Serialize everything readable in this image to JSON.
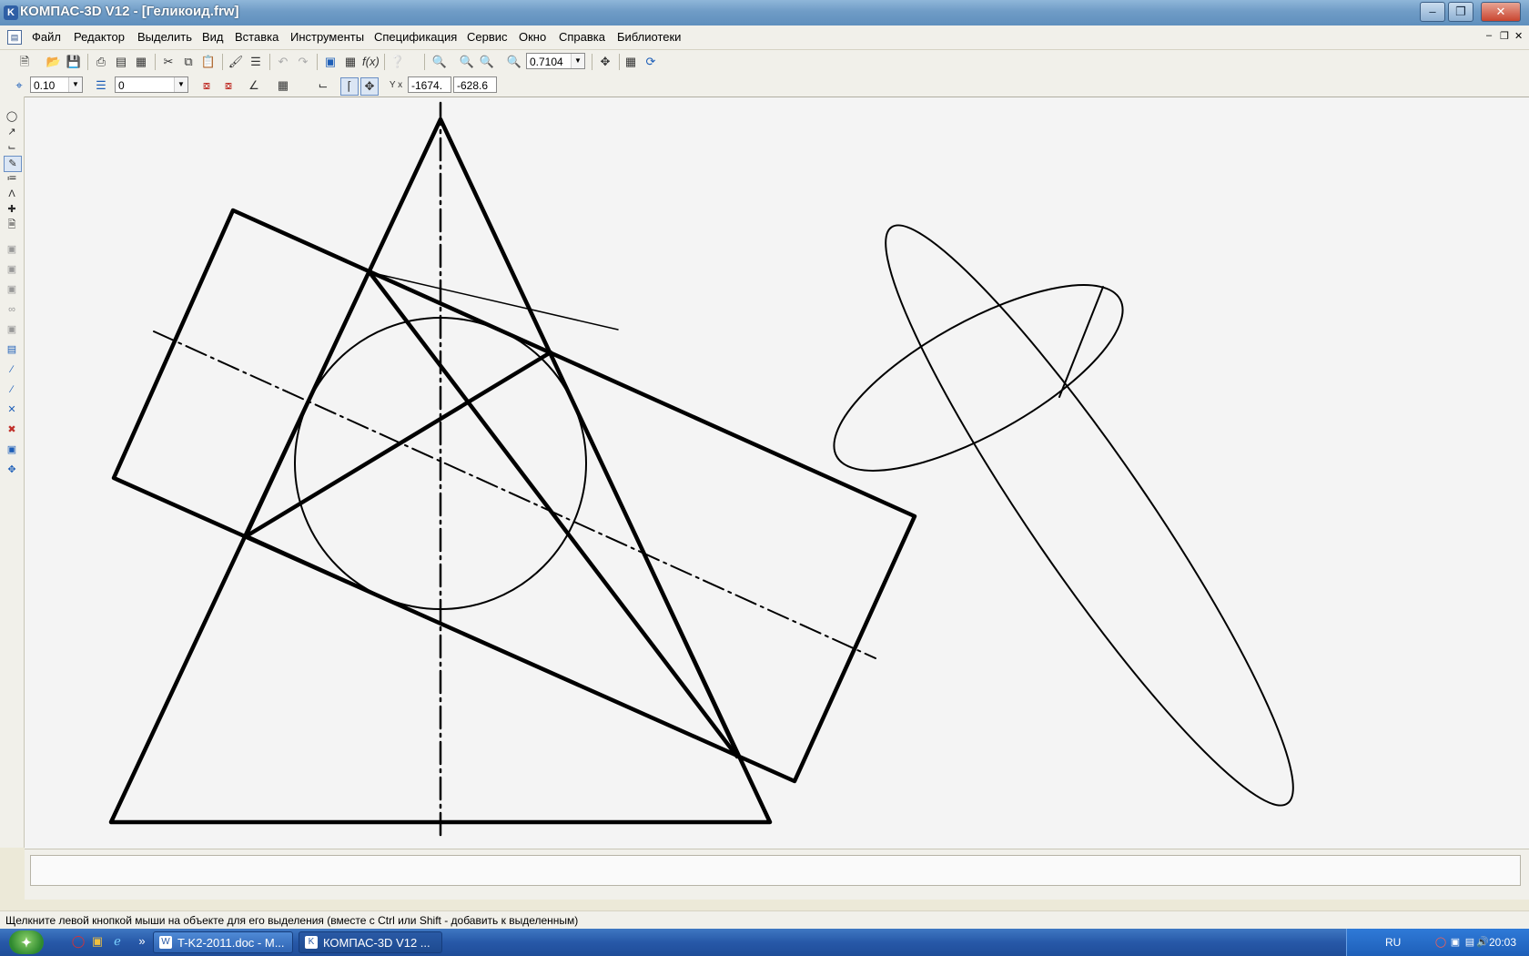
{
  "window": {
    "title": "КОМПАС-3D V12 - [Геликоид.frw]",
    "app_icon": "kompas-icon",
    "controls": [
      "minimize",
      "restore",
      "close"
    ]
  },
  "menu": {
    "items": [
      "Файл",
      "Редактор",
      "Выделить",
      "Вид",
      "Вставка",
      "Инструменты",
      "Спецификация",
      "Сервис",
      "Окно",
      "Справка",
      "Библиотеки"
    ]
  },
  "toolbar": {
    "zoom_value": "0.7104",
    "step_value": "0.10",
    "layer_value": "0",
    "coord_x": "-1674.",
    "coord_y": "-628.6",
    "coord_icon_label": "Y x"
  },
  "status": {
    "message": "Щелкните левой кнопкой мыши на объекте для его выделения (вместе с Ctrl или Shift - добавить к выделенным)"
  },
  "taskbar": {
    "items": [
      {
        "label": "T-K2-2011.doc - M...",
        "icon": "word-icon"
      },
      {
        "label": "КОМПАС-3D V12 ...",
        "icon": "kompas-icon"
      }
    ],
    "tray_lang": "RU",
    "clock": "20:03"
  }
}
